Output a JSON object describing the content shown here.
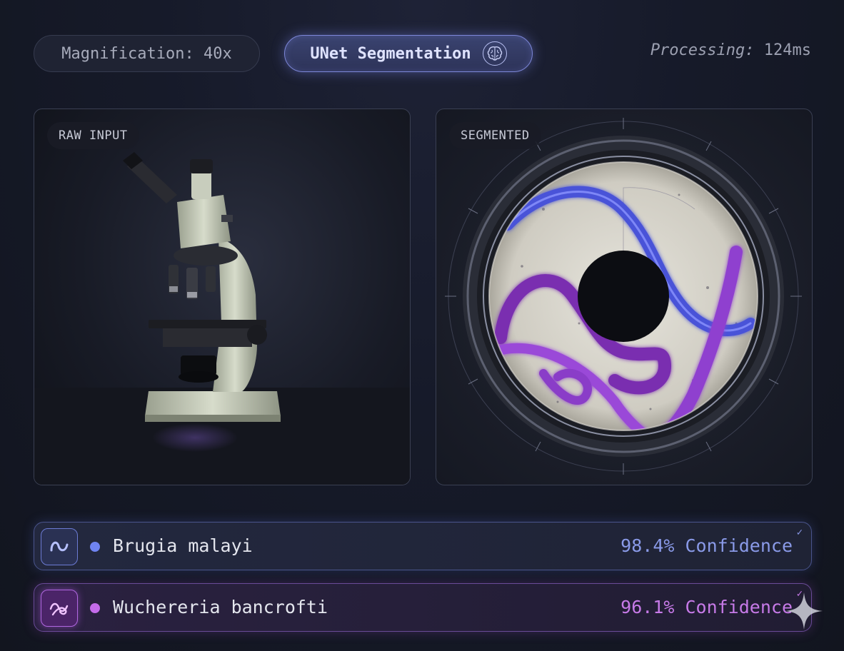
{
  "header": {
    "magnification": "Magnification: 40x",
    "model": "UNet Segmentation",
    "model_icon": "brain-icon",
    "processing_label": "Processing:",
    "processing_value": " 124ms"
  },
  "panels": {
    "raw": {
      "label": "RAW INPUT",
      "image": "microscope"
    },
    "segmented": {
      "label": "SEGMENTED",
      "image": "segmented-parasites-dial"
    }
  },
  "results": [
    {
      "name": "Brugia malayi",
      "confidence": "98.4% Confidence",
      "icon": "worm-icon",
      "color": "#6f84f2",
      "checked": true
    },
    {
      "name": "Wuchereria bancrofti",
      "confidence": "96.1% Confidence",
      "icon": "tangled-worm-icon",
      "color": "#c46bea",
      "checked": true
    }
  ],
  "colors": {
    "accent_blue": "#7d87d8",
    "accent_purple": "#b067e0",
    "background": "#161a29"
  }
}
